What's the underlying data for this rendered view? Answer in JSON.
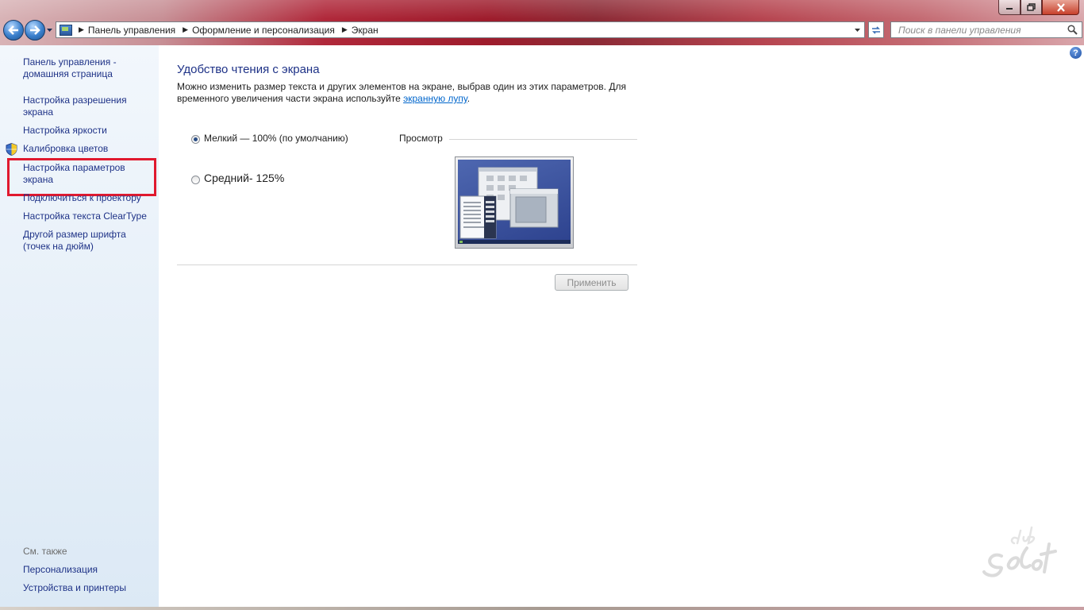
{
  "window": {
    "controls": {
      "minimize": "minimize-icon",
      "maximize": "maximize-icon",
      "close": "close-icon"
    }
  },
  "toolbar": {
    "back_icon": "back-arrow-icon",
    "forward_icon": "forward-arrow-icon",
    "breadcrumbs": [
      "Панель управления",
      "Оформление и персонализация",
      "Экран"
    ],
    "search_placeholder": "Поиск в панели управления"
  },
  "sidebar": {
    "items": [
      {
        "label": "Панель управления - домашняя страница"
      },
      {
        "label": "Настройка разрешения экрана"
      },
      {
        "label": "Настройка яркости"
      },
      {
        "label": "Калибровка цветов",
        "icon": "shield-icon"
      },
      {
        "label": "Настройка параметров экрана"
      },
      {
        "label": "Подключиться к проектору"
      },
      {
        "label": "Настройка текста ClearType"
      },
      {
        "label": "Другой размер шрифта (точек на дюйм)"
      }
    ],
    "see_also": {
      "title": "См. также",
      "items": [
        {
          "label": "Персонализация"
        },
        {
          "label": "Устройства и принтеры"
        }
      ]
    }
  },
  "main": {
    "heading": "Удобство чтения с экрана",
    "description_before_link": "Можно изменить размер текста и других элементов на экране, выбрав один из этих параметров. Для временного увеличения части экрана используйте ",
    "description_link": "экранную лупу",
    "description_after_link": ".",
    "options": [
      {
        "label": "Мелкий — 100% (по умолчанию)",
        "checked": true
      },
      {
        "label": "Средний- 125%",
        "checked": false
      }
    ],
    "preview_label": "Просмотр",
    "apply_label": "Применить"
  },
  "colors": {
    "link": "#1e3287",
    "highlight": "#e0192e",
    "sidebar_top": "#f2f7fc",
    "sidebar_bottom": "#dce9f5"
  }
}
